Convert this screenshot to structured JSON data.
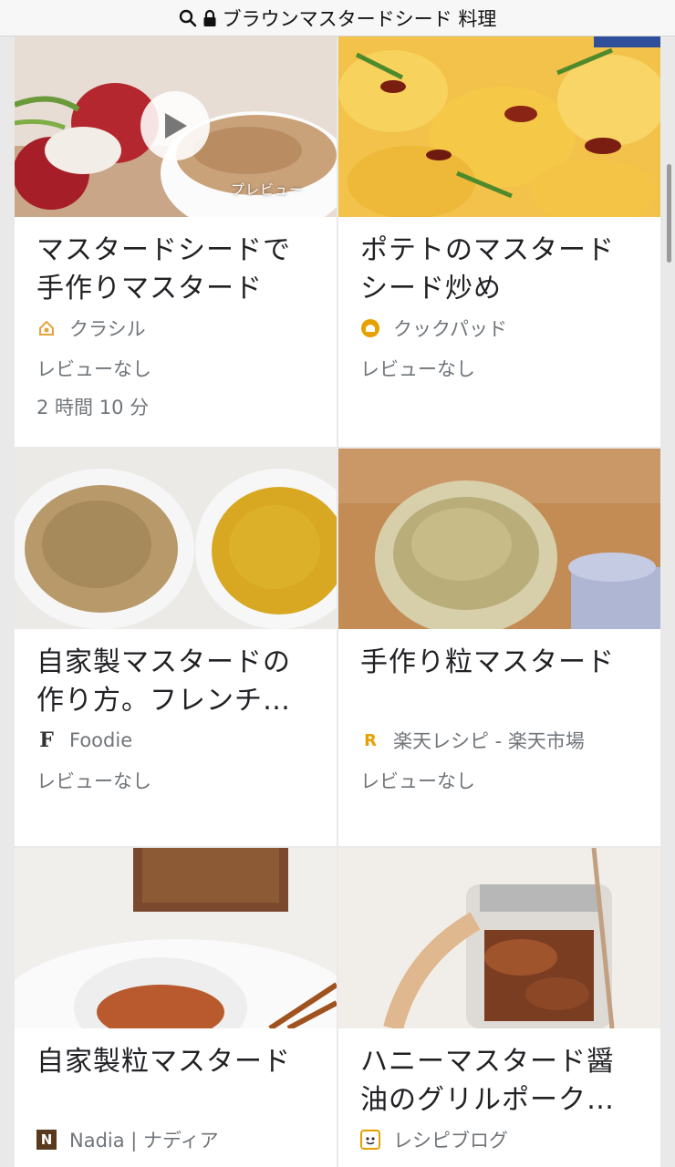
{
  "address_bar": {
    "query": "ブラウンマスタードシード 料理"
  },
  "cards": [
    {
      "title": "マスタードシードで手作りマスタード",
      "source": "クラシル",
      "review": "レビューなし",
      "time": "2 時間 10 分",
      "preview_label": "プレビュー",
      "source_icon": "kurashiru-logo"
    },
    {
      "title": "ポテトのマスタードシード炒め",
      "source": "クックパッド",
      "review": "レビューなし",
      "source_icon": "cookpad-logo"
    },
    {
      "title": "自家製マスタードの作り方。フレンチ・粒…",
      "source": "Foodie",
      "review": "レビューなし",
      "source_icon": "foodie-logo",
      "source_logo_letter": "F"
    },
    {
      "title": "手作り粒マスタード",
      "source": "楽天レシピ - 楽天市場",
      "review": "レビューなし",
      "source_icon": "rakuten-logo",
      "source_logo_letter": "R"
    },
    {
      "title": "自家製粒マスタード",
      "source": "Nadia | ナディア",
      "source_icon": "nadia-logo",
      "source_logo_letter": "N"
    },
    {
      "title": "ハニーマスタード醤油のグリルポークと白…",
      "source": "レシピブログ",
      "source_icon": "recipeblog-logo"
    }
  ],
  "colors": {
    "card_bg": "#ffffff",
    "page_bg": "#e9e9e9",
    "meta_text": "#70757a",
    "title_text": "#202124"
  }
}
